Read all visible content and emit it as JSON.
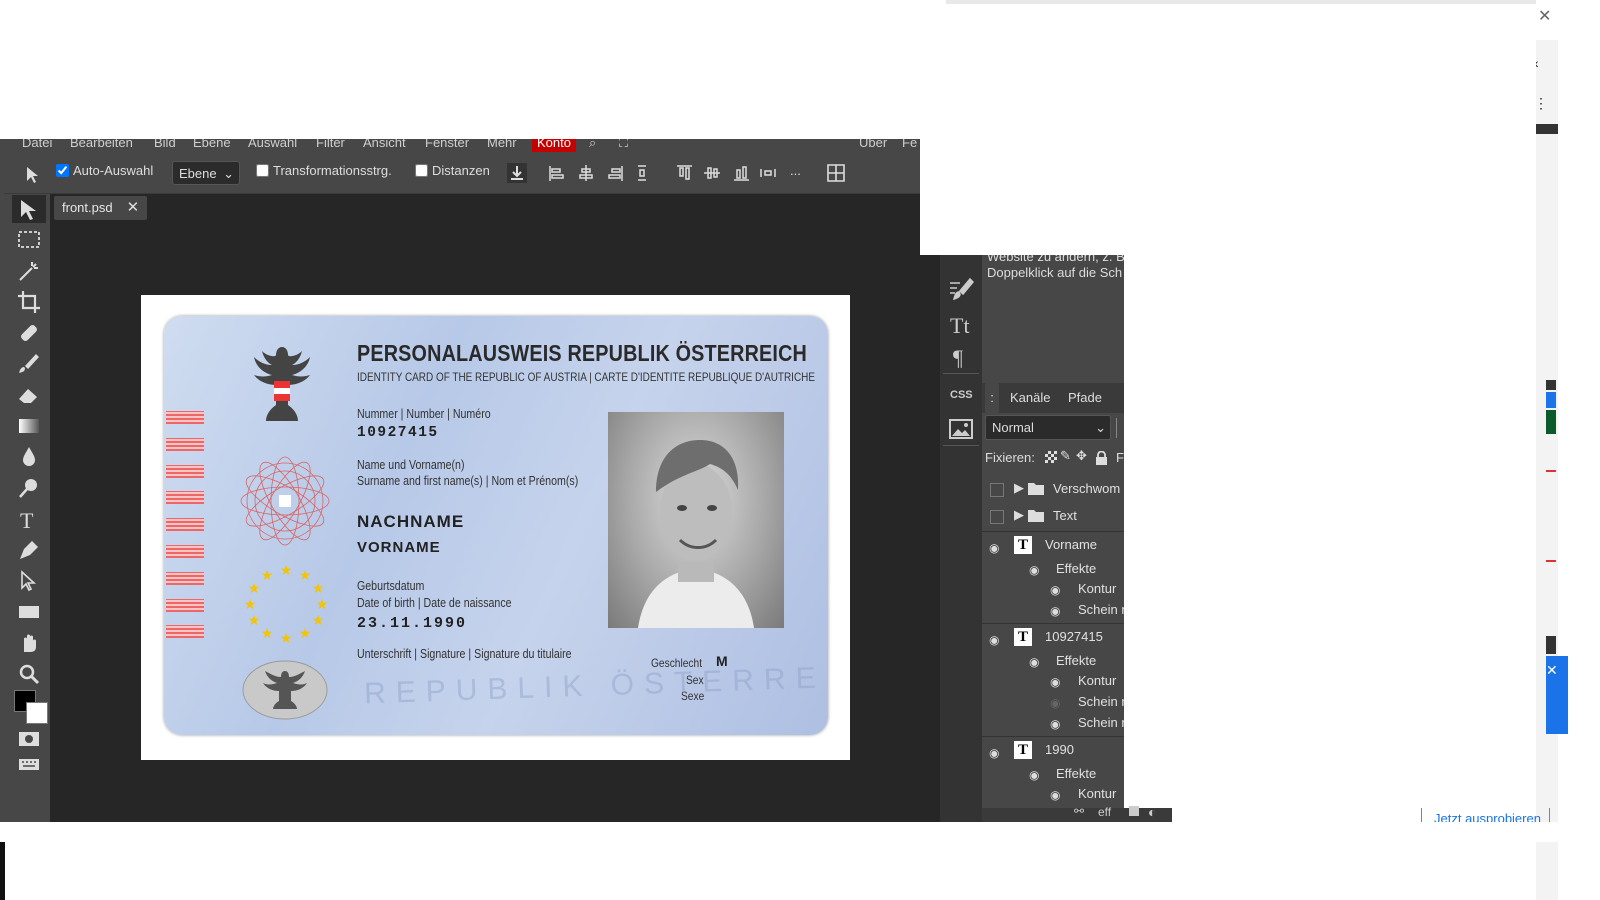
{
  "menu": {
    "items": [
      "Datei",
      "Bearbeiten",
      "Bild",
      "Ebene",
      "Auswahl",
      "Filter",
      "Ansicht",
      "Fenster",
      "Mehr"
    ],
    "konto": "Konto",
    "right_items": [
      "Über",
      "Fe"
    ]
  },
  "options": {
    "auto_select_label": "Auto-Auswahl",
    "auto_select_checked": true,
    "select_value": "Ebene",
    "transform_label": "Transformationsstrg.",
    "distances_label": "Distanzen",
    "more": "..."
  },
  "document": {
    "tab_title": "front.psd",
    "close": "✕"
  },
  "card": {
    "title": "PERSONALAUSWEIS REPUBLIK ÖSTERREICH",
    "subtitle": "IDENTITY CARD OF THE REPUBLIC OF AUSTRIA | CARTE D'IDENTITE REPUBLIQUE D'AUTRICHE",
    "number_label": "Nummer | Number | Numéro",
    "number": "10927415",
    "name_label1": "Name und Vorname(n)",
    "name_label2": "Surname and first name(s) | Nom et Prénom(s)",
    "surname": "NACHNAME",
    "firstname": "VORNAME",
    "dob_label1": "Geburtsdatum",
    "dob_label2": "Date of birth | Date de naissance",
    "dob": "23.11.1990",
    "signature_label": "Unterschrift | Signature | Signature du titulaire",
    "sex_label1": "Geschlecht",
    "sex_label2": "Sex",
    "sex_label3": "Sexe",
    "sex": "M",
    "watermark": "REPUBLIK ÖSTERREICH"
  },
  "side_info": {
    "line1": "Website zu ändern, z. B.",
    "line2": "Doppelklick auf die Sch"
  },
  "layers_panel": {
    "tabs": [
      ":",
      "Kanäle",
      "Pfade"
    ],
    "blend_mode": "Normal",
    "lock_label": "Fixieren:",
    "lock_extra": "F",
    "layers": [
      {
        "name": "Verschwom",
        "type": "folder"
      },
      {
        "name": "Text",
        "type": "folder"
      },
      {
        "name": "Vorname",
        "type": "text",
        "effects": "Effekte",
        "sub": [
          "Kontur",
          "Schein n"
        ]
      },
      {
        "name": "10927415",
        "type": "text",
        "effects": "Effekte",
        "sub": [
          "Kontur",
          "Schein n",
          "Schein n"
        ]
      },
      {
        "name": "1990",
        "type": "text",
        "effects": "Effekte",
        "sub": [
          "Kontur"
        ]
      }
    ],
    "footer": "eff"
  },
  "promo": {
    "link": "Jetzt ausprobieren"
  },
  "colors": {
    "app_bg": "#474747",
    "canvas_bg": "#262626",
    "konto": "#c50000",
    "accent_blue": "#1a73e8"
  }
}
